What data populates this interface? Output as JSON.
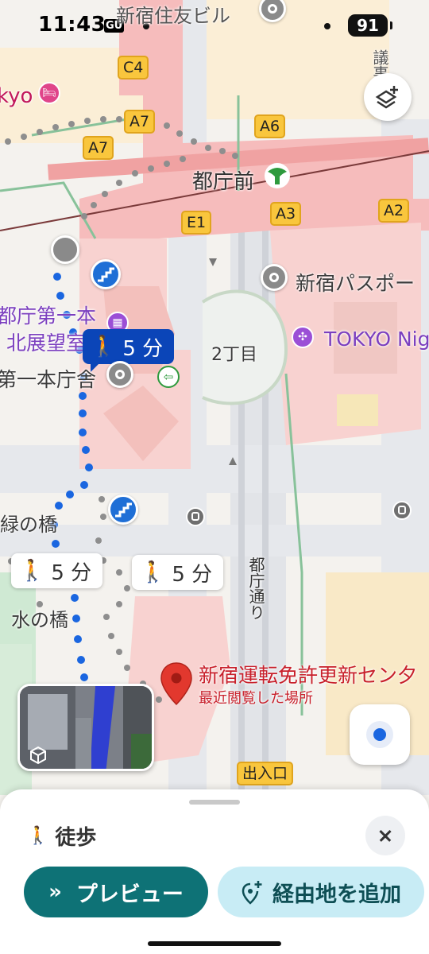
{
  "status_bar": {
    "time": "11:43",
    "carrier_badge": "GU",
    "battery": "91"
  },
  "map": {
    "exit_badges": [
      "C4",
      "A7",
      "A7",
      "A6",
      "E1",
      "A3",
      "A2",
      "出入口"
    ],
    "station_name": "都庁前",
    "labels": {
      "sumitomo": "新宿住友ビル",
      "hotel_fragment": "kyo",
      "side_kanji": "議事",
      "passport": "新宿パスポー",
      "tokyo_night": "TOKYO Nig",
      "observatory_line1": "都庁第一本",
      "observatory_line2": "北展望室",
      "first_building": "第一本庁舎",
      "chome": "2丁目",
      "midori_bridge": "緑の橋",
      "mizu_bridge": "水の橋",
      "tocho_street": "都庁通り",
      "destination_name": "新宿運転免許更新セン夕",
      "destination_sub": "最近閲覧した場所"
    },
    "walk_chips": [
      "5 分",
      "5 分",
      "5 分"
    ],
    "icons": {
      "layers": "layers-add-icon",
      "my_location": "my-location-icon",
      "stairs": "stairs-icon",
      "bus": "bus-stop-icon",
      "street_view": "street-view-icon",
      "destination": "red-pin-icon",
      "metro": "toei-subway-icon"
    },
    "colors": {
      "route_blue": "#1a66e0",
      "station_area": "#f2a8a8",
      "walk_chip_active": "#0b45b8",
      "destination_red": "#d93025"
    }
  },
  "sheet": {
    "mode_label": "徒歩",
    "preview_label": "プレビュー",
    "add_stop_label": "経由地を追加"
  }
}
